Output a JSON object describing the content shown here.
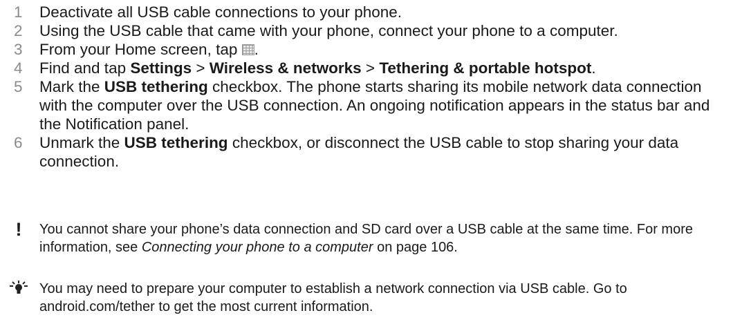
{
  "steps": [
    {
      "num": "1",
      "parts": [
        {
          "t": "Deactivate all USB cable connections to your phone."
        }
      ]
    },
    {
      "num": "2",
      "parts": [
        {
          "t": "Using the USB cable that came with your phone, connect your phone to a computer."
        }
      ]
    },
    {
      "num": "3",
      "parts": [
        {
          "t": "From your Home screen, tap "
        },
        {
          "icon": "apps-grid-icon"
        },
        {
          "t": "."
        }
      ]
    },
    {
      "num": "4",
      "parts": [
        {
          "t": "Find and tap "
        },
        {
          "t": "Settings",
          "b": true
        },
        {
          "t": " > "
        },
        {
          "t": "Wireless & networks",
          "b": true
        },
        {
          "t": " > "
        },
        {
          "t": "Tethering & portable hotspot",
          "b": true
        },
        {
          "t": "."
        }
      ]
    },
    {
      "num": "5",
      "parts": [
        {
          "t": "Mark the "
        },
        {
          "t": "USB tethering",
          "b": true
        },
        {
          "t": " checkbox. The phone starts sharing its mobile network data connection with the computer over the USB connection. An ongoing notification appears in the status bar and the Notification panel."
        }
      ]
    },
    {
      "num": "6",
      "parts": [
        {
          "t": "Unmark the "
        },
        {
          "t": "USB tethering",
          "b": true
        },
        {
          "t": " checkbox, or disconnect the USB cable to stop sharing your data connection."
        }
      ]
    }
  ],
  "notes": [
    {
      "icon": "exclamation-icon",
      "glyph": "!",
      "parts": [
        {
          "t": "You cannot share your phone’s data connection and SD card over a USB cable at the same time. For more information, see "
        },
        {
          "t": "Connecting your phone to a computer",
          "i": true
        },
        {
          "t": " on page 106."
        }
      ]
    },
    {
      "icon": "lightbulb-tip-icon",
      "glyph": "",
      "parts": [
        {
          "t": "You may need to prepare your computer to establish a network connection via USB cable. Go to android.com/tether to get the most current information."
        }
      ]
    }
  ]
}
